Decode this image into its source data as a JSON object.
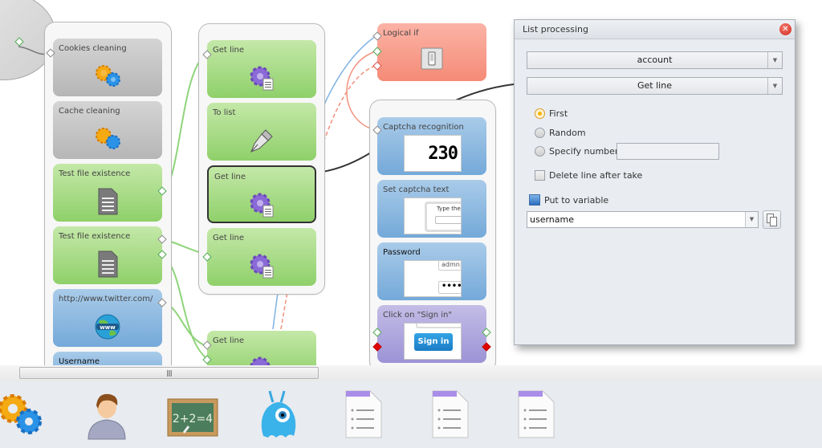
{
  "canvas": {
    "groups": {
      "col1": {
        "blocks": [
          {
            "title": "Cookies cleaning",
            "color": "gray",
            "icon": "gears-icon"
          },
          {
            "title": "Cache cleaning",
            "color": "gray",
            "icon": "gears-icon"
          },
          {
            "title": "Test file existence",
            "color": "green",
            "icon": "document-icon"
          },
          {
            "title": "Test file existence",
            "color": "green",
            "icon": "document-icon"
          },
          {
            "title": "http://www.twitter.com/",
            "color": "blue",
            "icon": "www-globe-icon"
          },
          {
            "title": "Username",
            "color": "blue",
            "icon": ""
          }
        ]
      },
      "col2": {
        "blocks": [
          {
            "title": "Get line",
            "color": "green",
            "icon": "list-gear-icon"
          },
          {
            "title": "To list",
            "color": "green",
            "icon": "pen-nib-icon"
          },
          {
            "title": "Get line",
            "color": "green",
            "icon": "list-gear-icon",
            "selected": true
          },
          {
            "title": "Get line",
            "color": "green",
            "icon": "list-gear-icon"
          }
        ]
      },
      "standalone": [
        {
          "title": "Get line",
          "color": "green",
          "icon": "list-gear-icon"
        },
        {
          "title": "Logical if",
          "color": "red",
          "icon": "switch-icon"
        }
      ],
      "col3": {
        "blocks": [
          {
            "title": "Captcha recognition",
            "color": "blue",
            "thumb_text": "230"
          },
          {
            "title": "Set captcha text",
            "color": "blue",
            "thumb_text": "Type the"
          },
          {
            "title": "Password",
            "color": "blue",
            "thumb_text": "admn|",
            "thumb_mask": "••••"
          },
          {
            "title": "Click on \"Sign in\"",
            "color": "purple",
            "thumb_text": "Sign in"
          }
        ]
      }
    }
  },
  "dialog": {
    "title": "List processing",
    "list_select": "account",
    "operation_select": "Get line",
    "options": [
      {
        "label": "First",
        "checked": true
      },
      {
        "label": "Random",
        "checked": false
      },
      {
        "label": "Specify number",
        "checked": false
      }
    ],
    "specify_number_value": "",
    "delete_line_label": "Delete line after take",
    "delete_line_checked": false,
    "put_to_variable_label": "Put to variable",
    "variable_value": "username"
  },
  "scrollbar": {
    "grip": "||||"
  },
  "toolbar": {
    "items": [
      {
        "icon": "gears-icon",
        "label": "Actions"
      },
      {
        "icon": "user-icon",
        "label": "User"
      },
      {
        "icon": "chalkboard-icon",
        "label": "2+2=4"
      },
      {
        "icon": "monster-icon",
        "label": "Monster"
      },
      {
        "icon": "list-document-icon",
        "label": "List"
      },
      {
        "icon": "list-document-icon",
        "label": "List"
      },
      {
        "icon": "list-document-icon",
        "label": "List"
      }
    ],
    "chalk_text": "2+2=4"
  },
  "colors": {
    "green_block": "#9dd67a",
    "blue_block": "#84b4de",
    "red_block": "#f79a88",
    "purple_block": "#aaa2dc",
    "gray_block": "#c4c4c4",
    "dialog_bg": "#e9ecf1",
    "radio_accent": "#f5b400",
    "close_red": "#d0281c"
  }
}
